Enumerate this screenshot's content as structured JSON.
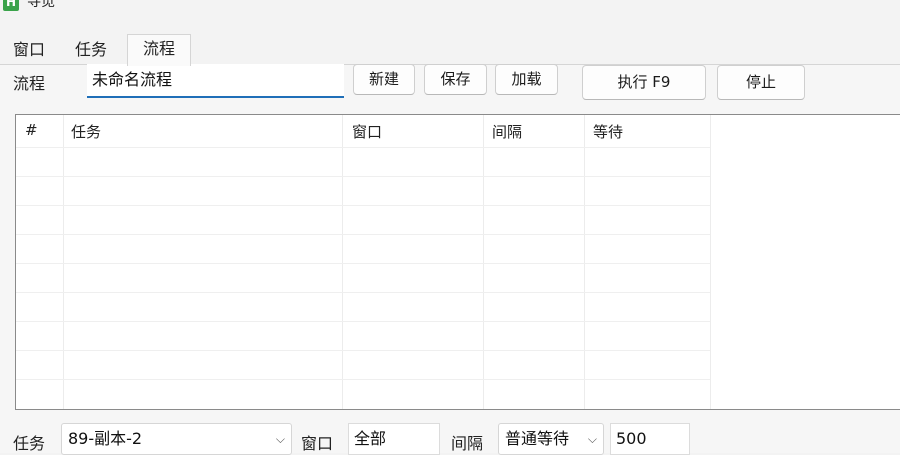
{
  "window": {
    "title": "寻觅",
    "icon": "H"
  },
  "tabs": [
    {
      "label": "窗口"
    },
    {
      "label": "任务"
    },
    {
      "label": "流程",
      "active": true
    }
  ],
  "flow": {
    "label": "流程",
    "name_value": "未命名流程",
    "buttons": {
      "new": "新建",
      "save": "保存",
      "load": "加载",
      "run": "执行 F9",
      "stop": "停止"
    }
  },
  "table": {
    "columns": [
      "#",
      "任务",
      "窗口",
      "间隔",
      "等待"
    ],
    "rows": []
  },
  "bottom": {
    "task_label": "任务",
    "task_value": "89-副本-2",
    "window_label": "窗口",
    "window_value": "全部",
    "interval_label": "间隔",
    "interval_mode": "普通等待",
    "interval_value": "500"
  }
}
